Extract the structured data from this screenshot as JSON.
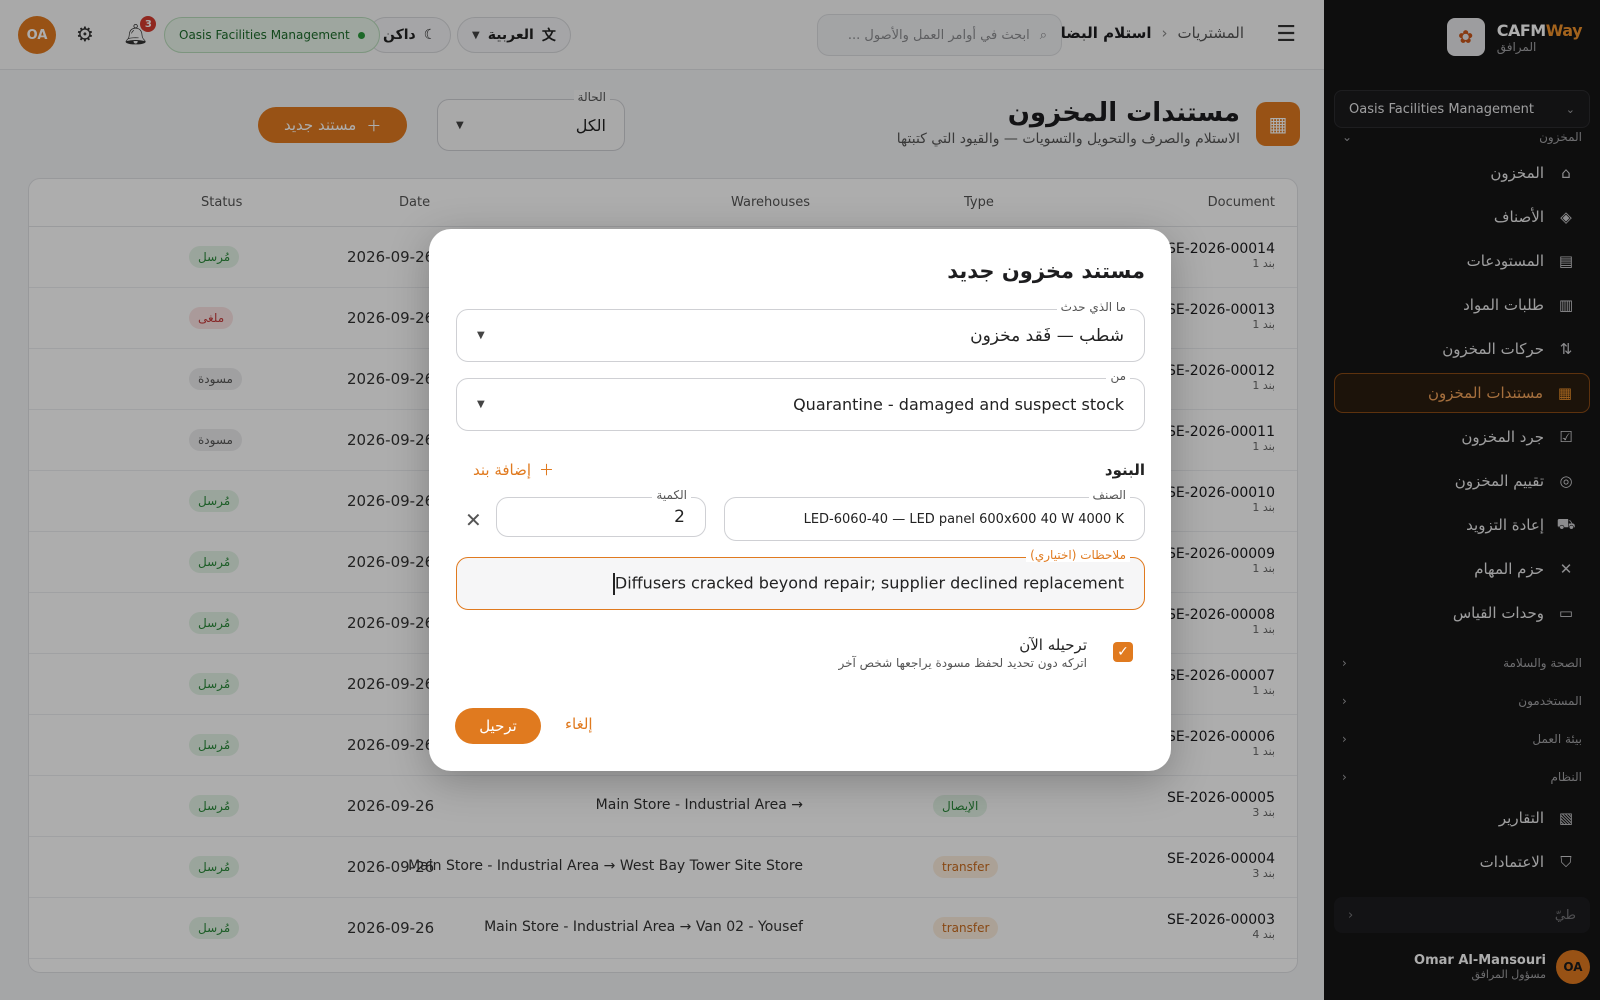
{
  "sidebar": {
    "brand_name_1": "CAFM",
    "brand_name_2": "Way",
    "brand_sub": "المرافق",
    "org": "Oasis Facilities Management",
    "section_inventory": "المخزون",
    "items": [
      {
        "label": "المخزون",
        "icon": "warehouse-icon",
        "glyph": "⌂"
      },
      {
        "label": "الأصناف",
        "icon": "shapes-icon",
        "glyph": "◈"
      },
      {
        "label": "المستودعات",
        "icon": "store-icon",
        "glyph": "▤"
      },
      {
        "label": "طلبات المواد",
        "icon": "clipboard-icon",
        "glyph": "▥"
      },
      {
        "label": "حركات المخزون",
        "icon": "arrows-updown-icon",
        "glyph": "⇅"
      },
      {
        "label": "مستندات المخزون",
        "icon": "document-icon",
        "glyph": "▦"
      },
      {
        "label": "جرد المخزون",
        "icon": "checklist-icon",
        "glyph": "☑"
      },
      {
        "label": "تقييم المخزون",
        "icon": "coin-icon",
        "glyph": "◎"
      },
      {
        "label": "إعادة التزويد",
        "icon": "truck-icon",
        "glyph": "⛟"
      },
      {
        "label": "حزم المهام",
        "icon": "tools-icon",
        "glyph": "✕"
      },
      {
        "label": "وحدات القياس",
        "icon": "ruler-icon",
        "glyph": "▭"
      }
    ],
    "sections": [
      "الصحة والسلامة",
      "المستخدمون",
      "بيئة العمل",
      "النظام"
    ],
    "bottom_items": [
      {
        "label": "التقارير",
        "icon": "report-icon",
        "glyph": "▧"
      },
      {
        "label": "الاعتمادات",
        "icon": "shield-check-icon",
        "glyph": "⛉"
      }
    ],
    "collapse_label": "طيّ",
    "user_initials": "OA",
    "user_name": "Omar Al-Mansouri",
    "user_role": "مسؤول المرافق"
  },
  "topbar": {
    "crumb_parent": "المشتريات",
    "crumb_current": "استلام البضائع",
    "search_placeholder": "ابحث في أوامر العمل والأصول ...",
    "lang_label": "العربية",
    "theme_label": "داكن",
    "org_label": "Oasis Facilities Management",
    "notif_count": "3",
    "user_initials": "OA"
  },
  "page": {
    "title": "مستندات المخزون",
    "subtitle": "الاستلام والصرف والتحويل والتسويات — والقيود التي كتبتها",
    "status_label": "الحالة",
    "status_value": "الكل",
    "new_doc_label": "مستند جديد"
  },
  "table": {
    "headers": {
      "document": "Document",
      "type": "Type",
      "warehouses": "Warehouses",
      "date": "Date",
      "status": "Status"
    },
    "rows": [
      {
        "doc": "SE-2026-00014",
        "lines": "1 بند",
        "type": "",
        "type_cls": "",
        "wh": "",
        "date": "2026-09-26",
        "status": "مُرسل",
        "status_cls": "b-sent"
      },
      {
        "doc": "SE-2026-00013",
        "lines": "1 بند",
        "type": "",
        "type_cls": "",
        "wh": "",
        "date": "2026-09-26",
        "status": "ملغى",
        "status_cls": "b-cancel"
      },
      {
        "doc": "SE-2026-00012",
        "lines": "1 بند",
        "type": "",
        "type_cls": "",
        "wh": "",
        "date": "2026-09-26",
        "status": "مسودة",
        "status_cls": "b-draft"
      },
      {
        "doc": "SE-2026-00011",
        "lines": "1 بند",
        "type": "",
        "type_cls": "",
        "wh": "",
        "date": "2026-09-26",
        "status": "مسودة",
        "status_cls": "b-draft"
      },
      {
        "doc": "SE-2026-00010",
        "lines": "1 بند",
        "type": "",
        "type_cls": "",
        "wh": "",
        "date": "2026-09-26",
        "status": "مُرسل",
        "status_cls": "b-sent"
      },
      {
        "doc": "SE-2026-00009",
        "lines": "1 بند",
        "type": "",
        "type_cls": "",
        "wh": "",
        "date": "2026-09-26",
        "status": "مُرسل",
        "status_cls": "b-sent"
      },
      {
        "doc": "SE-2026-00008",
        "lines": "1 بند",
        "type": "",
        "type_cls": "",
        "wh": "",
        "date": "2026-09-26",
        "status": "مُرسل",
        "status_cls": "b-sent"
      },
      {
        "doc": "SE-2026-00007",
        "lines": "1 بند",
        "type": "",
        "type_cls": "",
        "wh": "",
        "date": "2026-09-26",
        "status": "مُرسل",
        "status_cls": "b-sent"
      },
      {
        "doc": "SE-2026-00006",
        "lines": "1 بند",
        "type": "",
        "type_cls": "",
        "wh": "",
        "date": "2026-09-26",
        "status": "مُرسل",
        "status_cls": "b-sent"
      },
      {
        "doc": "SE-2026-00005",
        "lines": "3 بند",
        "type": "الإيصال",
        "type_cls": "b-receipt",
        "wh": "Main Store - Industrial Area →",
        "date": "2026-09-26",
        "status": "مُرسل",
        "status_cls": "b-sent"
      },
      {
        "doc": "SE-2026-00004",
        "lines": "3 بند",
        "type": "transfer",
        "type_cls": "b-transfer",
        "wh": "Main Store - Industrial Area → West Bay Tower Site Store",
        "date": "2026-09-26",
        "status": "مُرسل",
        "status_cls": "b-sent"
      },
      {
        "doc": "SE-2026-00003",
        "lines": "4 بند",
        "type": "transfer",
        "type_cls": "b-transfer",
        "wh": "Main Store - Industrial Area → Van 02 - Yousef",
        "date": "2026-09-26",
        "status": "مُرسل",
        "status_cls": "b-sent"
      }
    ]
  },
  "modal": {
    "title": "مستند مخزون جديد",
    "what_label": "ما الذي حدث",
    "what_value": "شطب — فَقد مخزون",
    "from_label": "من",
    "from_value": "Quarantine - damaged and suspect stock",
    "lines_label": "البنود",
    "add_line_label": "إضافة بند",
    "item_label": "الصنف",
    "item_value": "LED-6060-40 — LED panel 600x600 40 W 4000 K",
    "qty_label": "الكمية",
    "qty_value": "2",
    "notes_label": "ملاحظات (اختياري)",
    "notes_value": "Diffusers cracked beyond repair; supplier declined replacement",
    "post_now_label": "ترحيله الآن",
    "post_now_hint": "اتركه دون تحديد لحفظ مسودة يراجعها شخص آخر",
    "post_button": "ترحيل",
    "cancel_button": "إلغاء"
  },
  "colors": {
    "accent": "#e07a1f",
    "sidebar_bg": "#151515",
    "success": "#2a8a3a",
    "danger": "#c63a3a"
  }
}
